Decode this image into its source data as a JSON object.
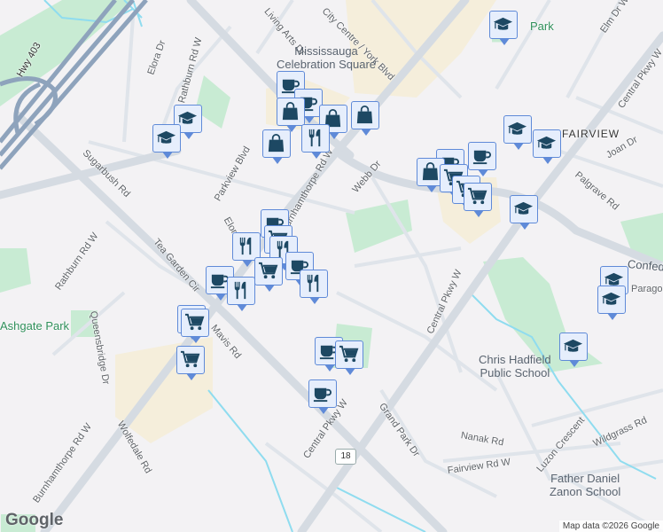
{
  "map": {
    "roads": {
      "hwy403": "Hwy 403",
      "rathburn_top": "Rathburn Rd W",
      "rathburn_left": "Rathburn Rd W",
      "burnhamthorpe_top": "Burnhamthorpe Rd W",
      "burnhamthorpe_bottom": "Burnhamthorpe Rd W",
      "central_pkwy_mid": "Central Pkwy W",
      "central_pkwy_low": "Central Pkwy W",
      "central_pkwy_e": "Central Pkwy W",
      "mavis": "Mavis Rd",
      "confederation": "Confed",
      "elora": "Elora Dr",
      "elora2": "Elora Dr",
      "sugarbush": "Sugarbush Rd",
      "parkview": "Parkview Blvd",
      "tea_garden": "Tea Garden Cir",
      "queensbridge": "Queensbridge Dr",
      "wolfedale": "Wolfedale Rd",
      "webb": "Webb Dr",
      "grand_park": "Grand Park Dr",
      "nanak": "Nanak Rd",
      "fairview_rd": "Fairview Rd W",
      "luzon": "Luzon Crescent",
      "wildgrass": "Wildgrass Rd",
      "palgrave": "Palgrave Rd",
      "joan": "Joan Dr",
      "elm": "Elm Dr W",
      "arts": "Living Arts Dr",
      "york": "City Centre / York Blvd",
      "paragon": "Paragon Dr",
      "route18": "18"
    },
    "places": {
      "celebration_square": [
        "Mississauga",
        "Celebration Square"
      ],
      "ashgate_park": "Ashgate Park",
      "park_top": "Park",
      "fairview": "FAIRVIEW",
      "chris_hadfield": [
        "Chris Hadfield",
        "Public School"
      ],
      "father_daniel": [
        "Father Daniel",
        "Zanon School"
      ]
    },
    "colors": {
      "marker_fill": "#e6eefc",
      "marker_border": "#5f8ad8",
      "icon": "#1d4863",
      "park": "#c8ebd3",
      "urban": "#f5eedb",
      "road": "#d7dde4"
    }
  },
  "footer": {
    "logo": "Google",
    "attribution": "Map data ©2026 Google"
  }
}
